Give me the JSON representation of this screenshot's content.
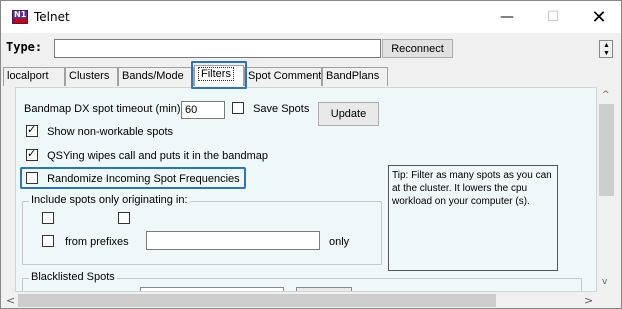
{
  "window": {
    "title": "Telnet",
    "icon": "n1mm-logo-icon",
    "logo_text": "N1",
    "minimize_glyph": "—",
    "maximize_glyph": "☐",
    "close_glyph": "✕"
  },
  "typebar": {
    "label": "Type:",
    "input_value": "",
    "reconnect_label": "Reconnect"
  },
  "tabs": [
    {
      "label": "localport",
      "active": false
    },
    {
      "label": "Clusters",
      "active": false
    },
    {
      "label": "Bands/Mode",
      "active": false
    },
    {
      "label": "Filters",
      "active": true
    },
    {
      "label": "Spot Comment",
      "active": false
    },
    {
      "label": "BandPlans",
      "active": false
    }
  ],
  "filters": {
    "timeout_label": "Bandmap DX spot timeout (min)",
    "timeout_value": "60",
    "save_spots_label": "Save Spots",
    "save_spots_checked": false,
    "update_label": "Update",
    "show_nonworkable_label": "Show non-workable spots",
    "show_nonworkable_checked": true,
    "qsying_label": "QSYing wipes call and puts it in the bandmap",
    "qsying_checked": true,
    "randomize_label": "Randomize Incoming Spot Frequencies",
    "randomize_checked": false,
    "tip": "Tip: Filter as many spots as you can at the cluster.  It lowers the cpu workload  on your computer (s).",
    "origin_group_label": "Include spots only originating in:",
    "from_prefixes_label": "from prefixes",
    "prefixes_value": "",
    "only_label": "only",
    "blacklisted_label": "Blacklisted Spots"
  },
  "scrollbars": {
    "up_arrow": "^",
    "down_arrow": "v",
    "left_arrow": "<",
    "right_arrow": ">"
  },
  "colors": {
    "highlight": "#2e75b6",
    "panel": "#eef8f8"
  }
}
